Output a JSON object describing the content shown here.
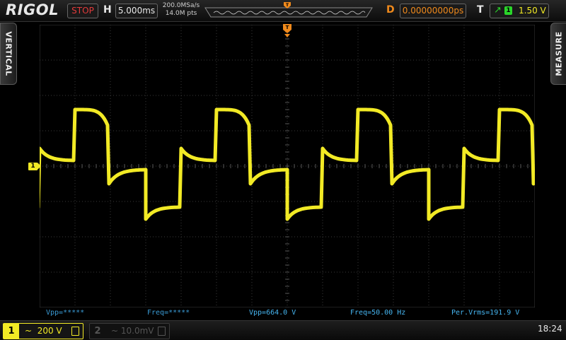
{
  "header": {
    "brand": "RIGOL",
    "run_status": "STOP",
    "h_label": "H",
    "timebase": "5.000ms",
    "sample_rate": "200.0MSa/s",
    "memory_depth": "14.0M pts",
    "d_label": "D",
    "delay": "0.00000000ps",
    "t_label": "T",
    "trigger_source": "1",
    "trigger_level": "1.50 V"
  },
  "side_tabs": {
    "left": "VERTICAL",
    "right": "MEASURE"
  },
  "screen": {
    "trigger_marker": "T",
    "ch1_marker": "1"
  },
  "measurements": [
    {
      "label": "Vpp=*****"
    },
    {
      "label": "Freq=*****"
    },
    {
      "label": "Vpp=664.0 V"
    },
    {
      "label": "Freq=50.00 Hz"
    },
    {
      "label": "Per.Vrms=191.9 V"
    }
  ],
  "footer": {
    "ch1": {
      "number": "1",
      "coupling_symbol": "~",
      "scale": "200 V"
    },
    "ch2": {
      "number": "2",
      "coupling_symbol": "~",
      "scale": "10.0mV"
    },
    "clock": "18:24"
  },
  "colors": {
    "ch1": "#f2ea25",
    "trigger": "#f08a1c",
    "measure": "#46b5f0",
    "stop": "#e23b3b",
    "grid": "#3a3a3a"
  }
}
